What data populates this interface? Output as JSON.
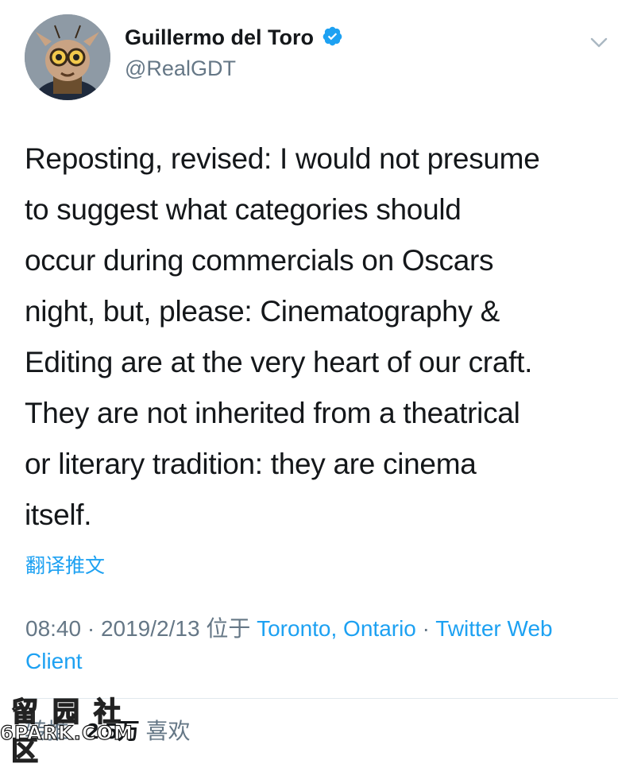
{
  "user": {
    "display_name": "Guillermo del Toro",
    "handle": "@RealGDT",
    "verified": true,
    "avatar_icon": "avatar-character-goggles"
  },
  "tweet": {
    "text": "Reposting, revised: I would not presume\nto suggest what categories should\noccur during commercials on Oscars\nnight,  but, please: Cinematography &\nEditing are at the very heart of our craft.\nThey are not inherited from a theatrical\nor literary tradition: they are cinema\nitself.",
    "translate_label": "翻译推文"
  },
  "meta": {
    "time": "08:40",
    "separator": " · ",
    "date": "2019/2/13",
    "location_prefix": " 位于 ",
    "location": "Toronto, Ontario",
    "client": "Twitter Web Client"
  },
  "stats": {
    "retweets_count": "",
    "retweets_label": "转推",
    "likes_count": "2.5万",
    "likes_label": "喜欢"
  },
  "watermark": {
    "top_text": "留园社区",
    "bottom_text": "6PARK.COM"
  },
  "colors": {
    "accent": "#1da1f2",
    "secondary_text": "#657786",
    "primary_text": "#14171a",
    "divider": "#e1e8ed"
  },
  "icons": {
    "verified": "verified-badge-icon",
    "menu": "chevron-down-icon"
  }
}
